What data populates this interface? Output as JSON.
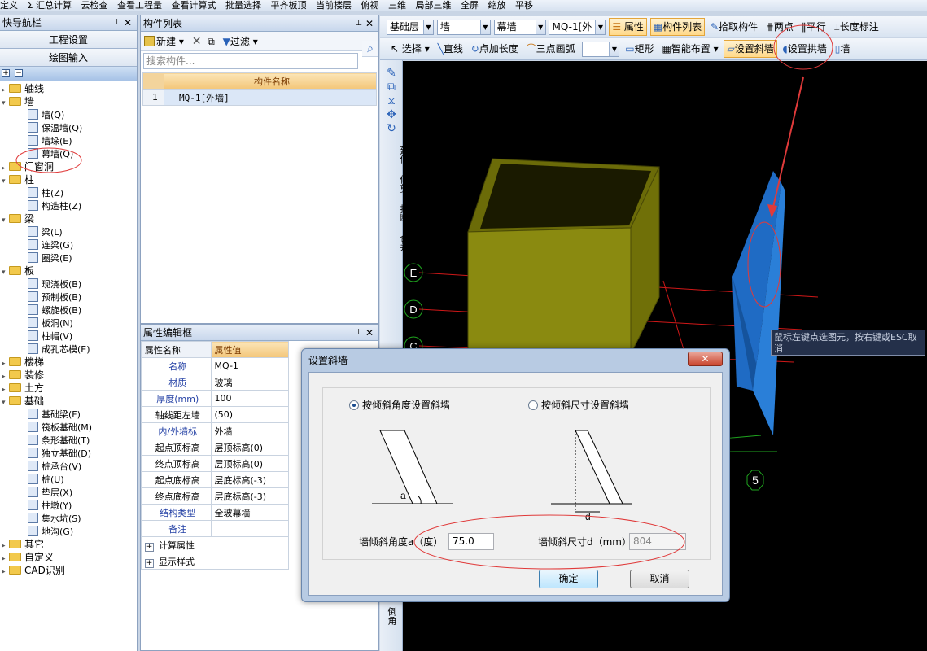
{
  "topbar": [
    "定义",
    "Σ 汇总计算",
    "云检查",
    "查看工程量",
    "查看计算式",
    "批量选择",
    "平齐板顶",
    "当前楼层",
    "俯视",
    "三维",
    "局部三维",
    "全屏",
    "缩放",
    "平移"
  ],
  "nav": {
    "title": "快导航栏",
    "btn_project": "工程设置",
    "btn_draw": "绘图输入",
    "tree": [
      {
        "kind": "folder",
        "label": "轴线",
        "level": 0,
        "open": false
      },
      {
        "kind": "folder",
        "label": "墙",
        "level": 0,
        "open": true
      },
      {
        "kind": "leaf",
        "label": "墙(Q)",
        "level": 1
      },
      {
        "kind": "leaf",
        "label": "保温墙(Q)",
        "level": 1
      },
      {
        "kind": "leaf",
        "label": "墙垛(E)",
        "level": 1
      },
      {
        "kind": "leaf",
        "label": "幕墙(Q)",
        "level": 1
      },
      {
        "kind": "folder",
        "label": "门窗洞",
        "level": 0,
        "open": false
      },
      {
        "kind": "folder",
        "label": "柱",
        "level": 0,
        "open": true
      },
      {
        "kind": "leaf",
        "label": "柱(Z)",
        "level": 1
      },
      {
        "kind": "leaf",
        "label": "构造柱(Z)",
        "level": 1
      },
      {
        "kind": "folder",
        "label": "梁",
        "level": 0,
        "open": true
      },
      {
        "kind": "leaf",
        "label": "梁(L)",
        "level": 1
      },
      {
        "kind": "leaf",
        "label": "连梁(G)",
        "level": 1
      },
      {
        "kind": "leaf",
        "label": "圈梁(E)",
        "level": 1
      },
      {
        "kind": "folder",
        "label": "板",
        "level": 0,
        "open": true
      },
      {
        "kind": "leaf",
        "label": "现浇板(B)",
        "level": 1
      },
      {
        "kind": "leaf",
        "label": "预制板(B)",
        "level": 1
      },
      {
        "kind": "leaf",
        "label": "螺旋板(B)",
        "level": 1
      },
      {
        "kind": "leaf",
        "label": "板洞(N)",
        "level": 1
      },
      {
        "kind": "leaf",
        "label": "柱帽(V)",
        "level": 1
      },
      {
        "kind": "leaf",
        "label": "成孔芯模(E)",
        "level": 1
      },
      {
        "kind": "folder",
        "label": "楼梯",
        "level": 0,
        "open": false
      },
      {
        "kind": "folder",
        "label": "装修",
        "level": 0,
        "open": false
      },
      {
        "kind": "folder",
        "label": "土方",
        "level": 0,
        "open": false
      },
      {
        "kind": "folder",
        "label": "基础",
        "level": 0,
        "open": true
      },
      {
        "kind": "leaf",
        "label": "基础梁(F)",
        "level": 1
      },
      {
        "kind": "leaf",
        "label": "筏板基础(M)",
        "level": 1
      },
      {
        "kind": "leaf",
        "label": "条形基础(T)",
        "level": 1
      },
      {
        "kind": "leaf",
        "label": "独立基础(D)",
        "level": 1
      },
      {
        "kind": "leaf",
        "label": "桩承台(V)",
        "level": 1
      },
      {
        "kind": "leaf",
        "label": "桩(U)",
        "level": 1
      },
      {
        "kind": "leaf",
        "label": "垫层(X)",
        "level": 1
      },
      {
        "kind": "leaf",
        "label": "柱墩(Y)",
        "level": 1
      },
      {
        "kind": "leaf",
        "label": "集水坑(S)",
        "level": 1
      },
      {
        "kind": "leaf",
        "label": "地沟(G)",
        "level": 1
      },
      {
        "kind": "folder",
        "label": "其它",
        "level": 0,
        "open": false
      },
      {
        "kind": "folder",
        "label": "自定义",
        "level": 0,
        "open": false
      },
      {
        "kind": "folder",
        "label": "CAD识别",
        "level": 0,
        "open": false
      }
    ]
  },
  "components": {
    "title": "构件列表",
    "new_label": "新建",
    "filter_label": "过滤",
    "search_placeholder": "搜索构件...",
    "col_header": "构件名称",
    "rows": [
      {
        "num": "1",
        "name": "MQ-1[外墙]"
      }
    ]
  },
  "props": {
    "title": "属性编辑框",
    "col_name": "属性名称",
    "col_value": "属性值",
    "rows": [
      {
        "name": "名称",
        "value": "MQ-1",
        "blue": true
      },
      {
        "name": "材质",
        "value": "玻璃",
        "blue": true
      },
      {
        "name": "厚度(mm)",
        "value": "100",
        "blue": true
      },
      {
        "name": "轴线距左墙",
        "value": "(50)",
        "blue": false
      },
      {
        "name": "内/外墙标",
        "value": "外墙",
        "blue": true
      },
      {
        "name": "起点顶标高",
        "value": "层顶标高(0)",
        "blue": false
      },
      {
        "name": "终点顶标高",
        "value": "层顶标高(0)",
        "blue": false
      },
      {
        "name": "起点底标高",
        "value": "层底标高(-3)",
        "blue": false
      },
      {
        "name": "终点底标高",
        "value": "层底标高(-3)",
        "blue": false
      },
      {
        "name": "结构类型",
        "value": "全玻幕墙",
        "blue": true
      },
      {
        "name": "备注",
        "value": "",
        "blue": true
      }
    ],
    "groups": [
      "计算属性",
      "显示样式"
    ]
  },
  "toolbar1": {
    "floor": "基础层",
    "type": "墙",
    "subtype": "幕墙",
    "component": "MQ-1[外",
    "attr_btn": "属性",
    "list_btn": "构件列表",
    "pick_btn": "拾取构件",
    "two_point": "两点",
    "parallel": "平行",
    "dim": "长度标注"
  },
  "toolbar2": {
    "select": "选择",
    "line": "直线",
    "point_len": "点加长度",
    "arc": "三点画弧",
    "rect": "矩形",
    "smart": "智能布置",
    "slant": "设置斜墙",
    "arch": "设置拱墙",
    "more": "墙"
  },
  "vstrip": [
    "延伸",
    "修剪",
    "打断",
    "合并",
    "倒角"
  ],
  "canvas": {
    "axis_labels": [
      "E",
      "D",
      "C",
      "5"
    ],
    "tooltip": "鼠标左键点选图元，按右键或ESC取消",
    "colors": {
      "bg": "#000000",
      "box": "#8a8a10",
      "wall": "#1f6bc4",
      "axis": "#d01818",
      "grid": "#1fa51f"
    }
  },
  "dialog": {
    "title": "设置斜墙",
    "opt_angle": "按倾斜角度设置斜墙",
    "opt_size": "按倾斜尺寸设置斜墙",
    "diag_a": "a",
    "diag_d": "d",
    "angle_label": "墙倾斜角度a（度）",
    "angle_value": "75.0",
    "size_label": "墙倾斜尺寸d（mm）",
    "size_value": "804",
    "ok": "确定",
    "cancel": "取消"
  }
}
